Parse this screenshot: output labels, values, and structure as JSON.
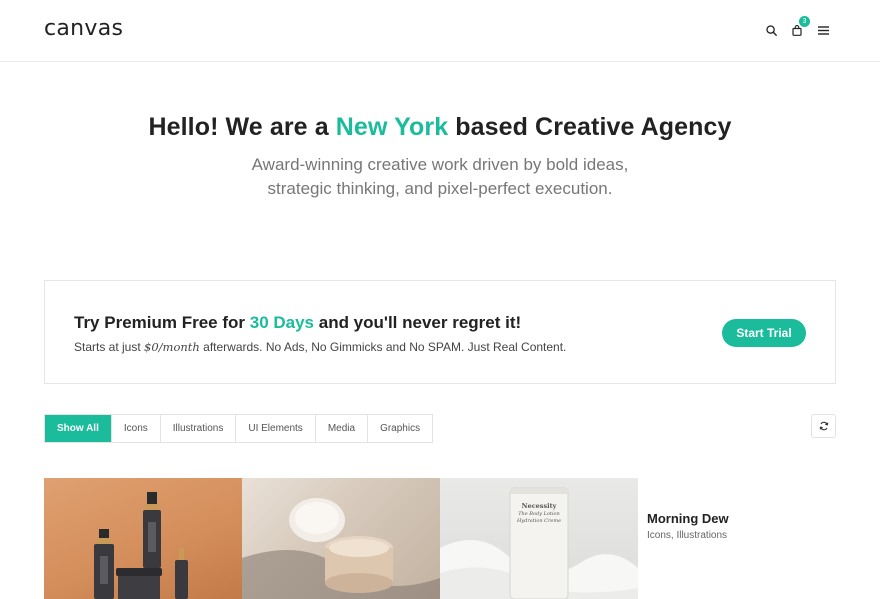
{
  "header": {
    "logo": "canvas",
    "cart_count": "3",
    "icons": [
      "search-icon",
      "shopping-bag-icon",
      "menu-icon"
    ]
  },
  "hero": {
    "title_before": "Hello! We are a ",
    "title_accent": "New York",
    "title_after": " based Creative Agency",
    "subtitle_line1": "Award-winning creative work driven by bold ideas,",
    "subtitle_line2": "strategic thinking, and pixel-perfect execution."
  },
  "promo": {
    "title_before": "Try Premium Free for ",
    "title_accent": "30 Days",
    "title_after": " and you'll never regret it!",
    "text_before": "Starts at just ",
    "text_price": "$0/month",
    "text_after": " afterwards. No Ads, No Gimmicks and No SPAM. Just Real Content.",
    "button": "Start Trial"
  },
  "filters": {
    "items": [
      "Show All",
      "Icons",
      "Illustrations",
      "UI Elements",
      "Media",
      "Graphics"
    ],
    "active": "Show All"
  },
  "portfolio": {
    "item_title": "Morning Dew",
    "item_categories": "Icons, Illustrations",
    "tube_label_1": "Necessity",
    "tube_label_2": "The Body Lotion",
    "tube_label_3": "Hydration Creme"
  },
  "colors": {
    "accent": "#1abc9c",
    "text_dark": "#222222",
    "text_muted": "#777777"
  }
}
